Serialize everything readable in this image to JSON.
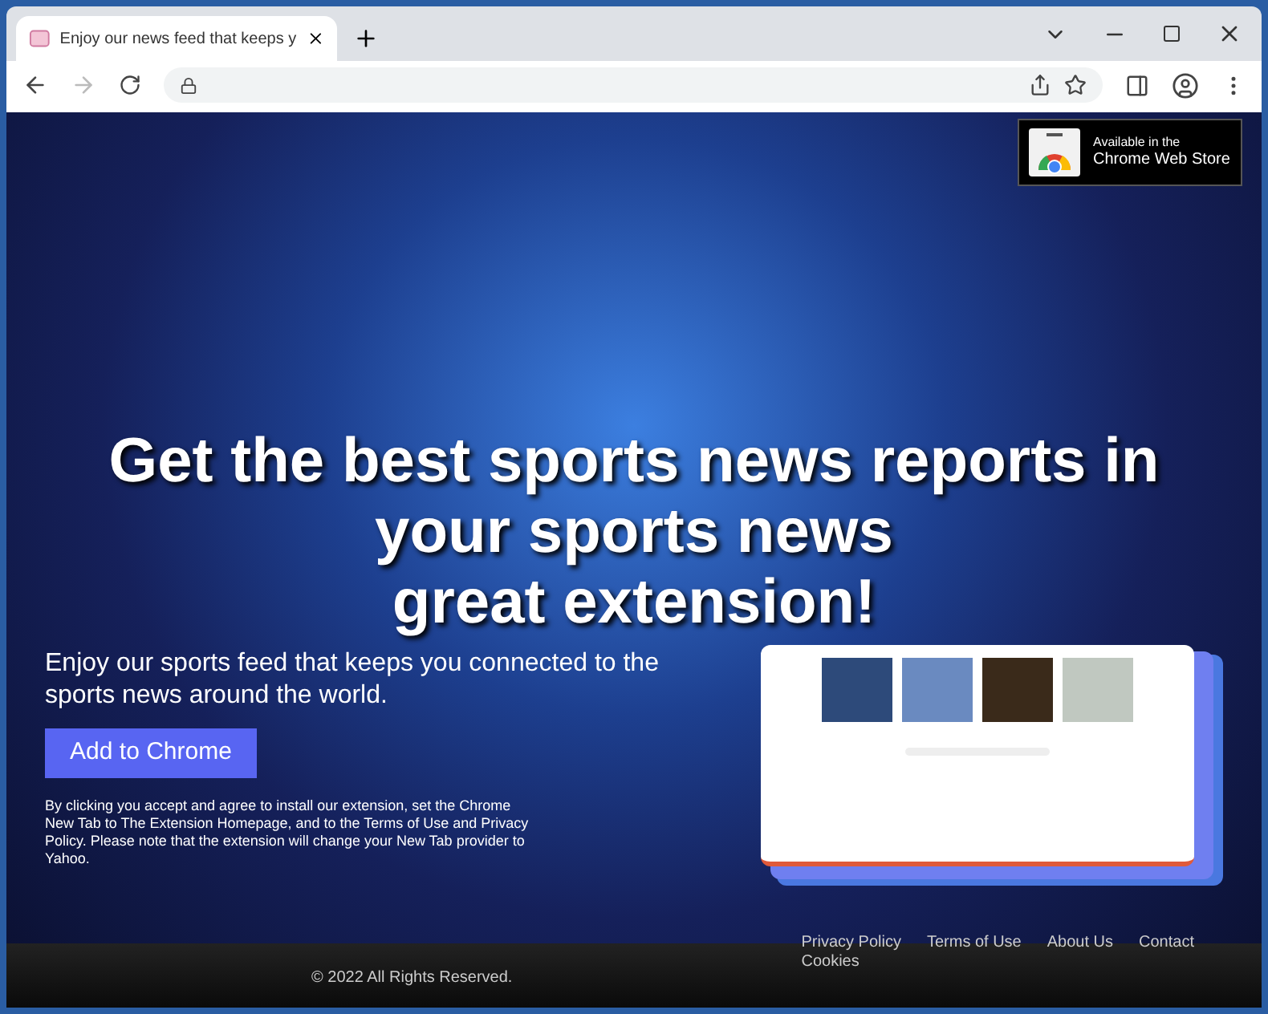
{
  "browser": {
    "tab": {
      "title": "Enjoy our news feed that keeps y"
    }
  },
  "page": {
    "store_badge": {
      "line_1": "Available in the",
      "line_2": "Chrome Web Store"
    },
    "headline_lines": [
      "Get the best sports news reports in",
      "your sports news",
      "great extension!"
    ],
    "tagline": "Enjoy our sports feed that keeps you connected to the sports news around the world.",
    "cta": "Add to Chrome",
    "disclaimer": "By clicking you accept and agree to install our extension, set the Chrome New Tab to The Extension Homepage, and to the Terms of Use and Privacy Policy. Please note that the extension will change your New Tab provider to Yahoo.",
    "footer": {
      "copyright": "© 2022 All Rights Reserved.",
      "links": [
        "Privacy Policy",
        "Terms of Use",
        "About Us",
        "Contact",
        "Cookies"
      ]
    }
  }
}
